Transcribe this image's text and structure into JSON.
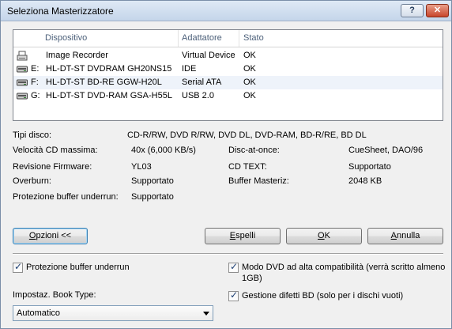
{
  "window": {
    "title": "Seleziona Masterizzatore"
  },
  "list": {
    "headers": {
      "device": "Dispositivo",
      "adapter": "Adattatore",
      "status": "Stato"
    },
    "rows": [
      {
        "letter": "",
        "device": "Image Recorder",
        "adapter": "Virtual Device",
        "status": "OK",
        "icon": "image-recorder-icon"
      },
      {
        "letter": "E:",
        "device": "HL-DT-ST DVDRAM GH20NS15",
        "adapter": "IDE",
        "status": "OK",
        "icon": "optical-drive-icon"
      },
      {
        "letter": "F:",
        "device": "HL-DT-ST BD-RE  GGW-H20L",
        "adapter": "Serial ATA",
        "status": "OK",
        "icon": "optical-drive-icon"
      },
      {
        "letter": "G:",
        "device": "HL-DT-ST DVD-RAM GSA-H55L",
        "adapter": "USB 2.0",
        "status": "OK",
        "icon": "optical-drive-icon"
      }
    ]
  },
  "props": {
    "disc_types_label": "Tipi disco:",
    "disc_types_value": "CD-R/RW, DVD R/RW, DVD DL, DVD-RAM, BD-R/RE, BD DL",
    "max_speed_label": "Velocità CD massima:",
    "max_speed_value": "40x (6,000 KB/s)",
    "dao_label": "Disc-at-once:",
    "dao_value": "CueSheet, DAO/96",
    "firmware_label": "Revisione Firmware:",
    "firmware_value": "YL03",
    "cdtext_label": "CD TEXT:",
    "cdtext_value": "Supportato",
    "overburn_label": "Overburn:",
    "overburn_value": "Supportato",
    "buffer_label": "Buffer Masteriz:",
    "buffer_value": "2048 KB",
    "underrun_label": "Protezione buffer underrun:",
    "underrun_value": "Supportato"
  },
  "buttons": {
    "options_prefix": "O",
    "options_rest": "pzioni <<",
    "eject_prefix": "E",
    "eject_rest": "spelli",
    "ok_prefix": "O",
    "ok_rest": "K",
    "cancel_prefix": "A",
    "cancel_rest": "nnulla"
  },
  "options": {
    "underrun_protection": "Protezione buffer underrun",
    "dvd_compat": "Modo DVD ad alta compatibilità (verrà scritto almeno",
    "dvd_compat_line2": "1GB)",
    "bd_defect": "Gestione difetti BD (solo per i dischi vuoti)",
    "booktype_label": "Impostaz. Book Type:",
    "booktype_value": "Automatico"
  }
}
